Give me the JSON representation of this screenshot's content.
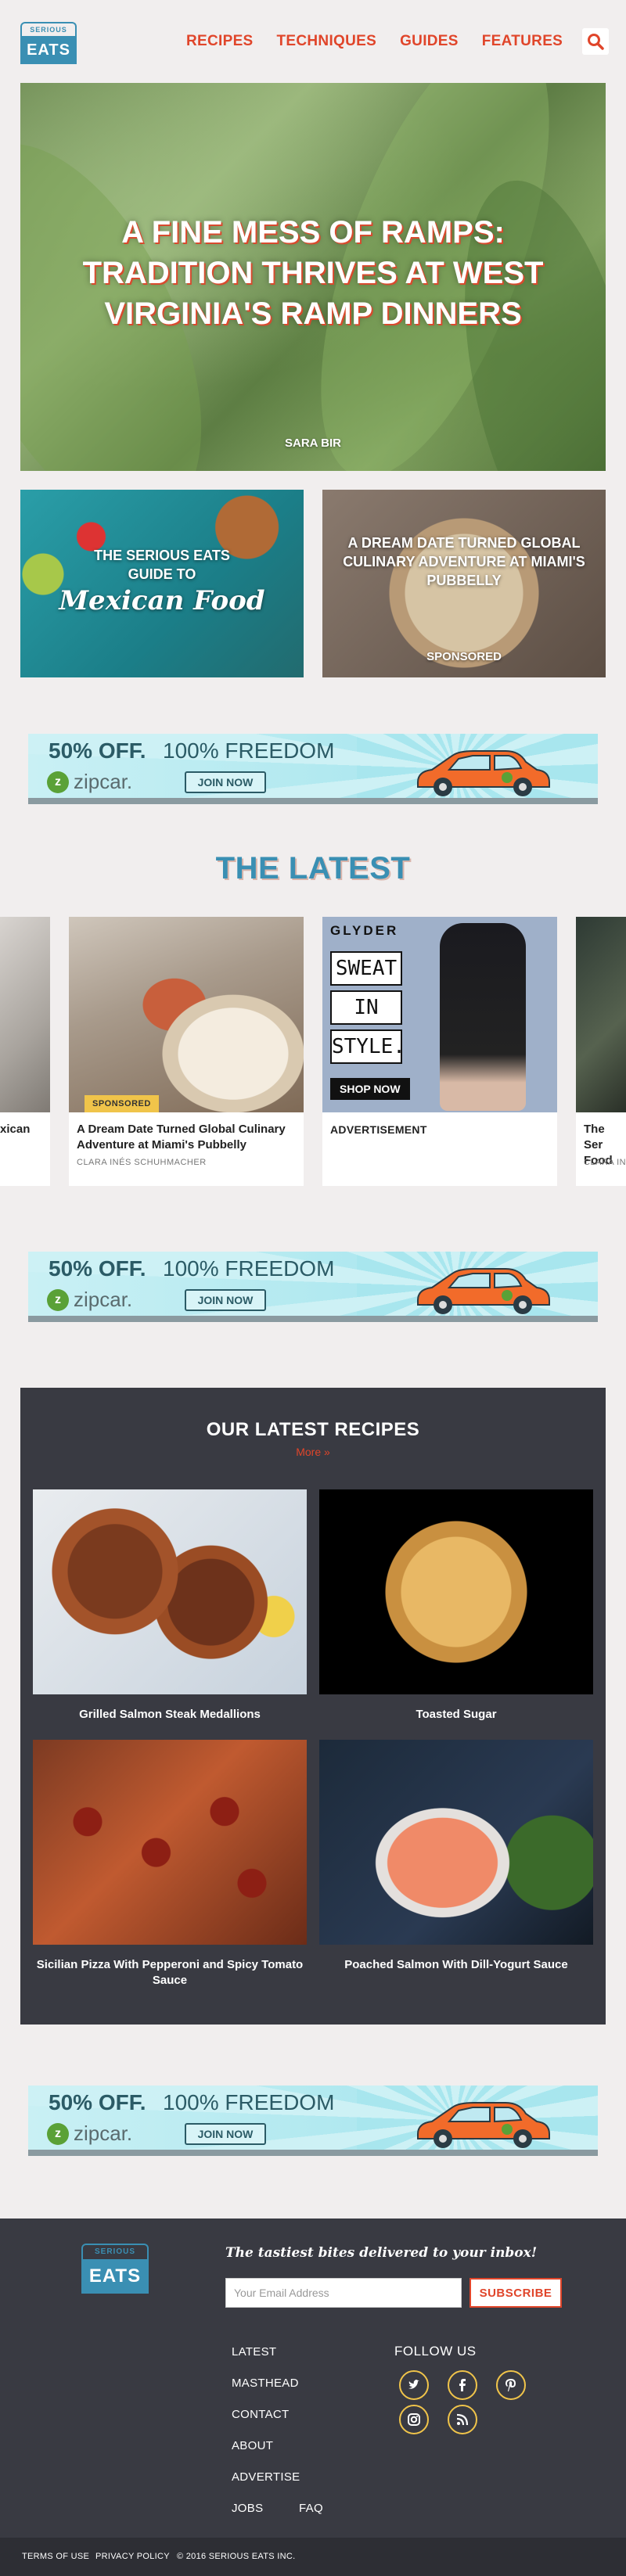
{
  "brand": {
    "top": "SERIOUS",
    "bottom": "EATS"
  },
  "nav": [
    "RECIPES",
    "TECHNIQUES",
    "GUIDES",
    "FEATURES"
  ],
  "hero": {
    "title": "A FINE MESS OF RAMPS: TRADITION THRIVES AT WEST VIRGINIA'S RAMP DINNERS",
    "author": "SARA BIR"
  },
  "features": [
    {
      "line1": "THE SERIOUS EATS",
      "line2": "GUIDE TO",
      "script": "Mexican Food"
    },
    {
      "title": "A DREAM DATE TURNED GLOBAL CULINARY ADVENTURE AT MIAMI'S PUBBELLY",
      "tag": "SPONSORED"
    }
  ],
  "ad": {
    "off": "50% OFF.",
    "freedom": "100% FREEDOM",
    "zip_mark": "z",
    "zipcar": "zipcar.",
    "join": "JOIN NOW"
  },
  "latest": {
    "title": "THE LATEST",
    "left_partial": "xican",
    "cards": [
      {
        "tag": "SPONSORED",
        "title": "A Dream Date Turned Global Culinary Adventure at Miami's Pubbelly",
        "author": "CLARA INÉS SCHUHMACHER"
      },
      {
        "brand": "GLYDER",
        "words": [
          "SWEAT",
          "IN",
          "STYLE."
        ],
        "cta": "SHOP NOW",
        "title": "ADVERTISEMENT"
      }
    ],
    "right_partial": {
      "title": "The Ser Food",
      "author": "CLARA INÉ"
    }
  },
  "recipes": {
    "title": "OUR LATEST RECIPES",
    "more": "More »",
    "items": [
      {
        "caption": "Grilled Salmon Steak Medallions"
      },
      {
        "caption": "Toasted Sugar"
      },
      {
        "caption": "Sicilian Pizza With Pepperoni and Spicy Tomato Sauce"
      },
      {
        "caption": "Poached Salmon With Dill-Yogurt Sauce"
      }
    ]
  },
  "footer": {
    "tagline": "The tastiest bites delivered to your inbox!",
    "email_placeholder": "Your Email Address",
    "subscribe": "SUBSCRIBE",
    "links": [
      "LATEST",
      "MASTHEAD",
      "CONTACT",
      "ABOUT",
      "ADVERTISE",
      "JOBS",
      "FAQ"
    ],
    "follow": "FOLLOW US",
    "bottom": [
      "TERMS OF USE",
      "PRIVACY POLICY",
      "© 2016 SERIOUS EATS INC."
    ]
  }
}
